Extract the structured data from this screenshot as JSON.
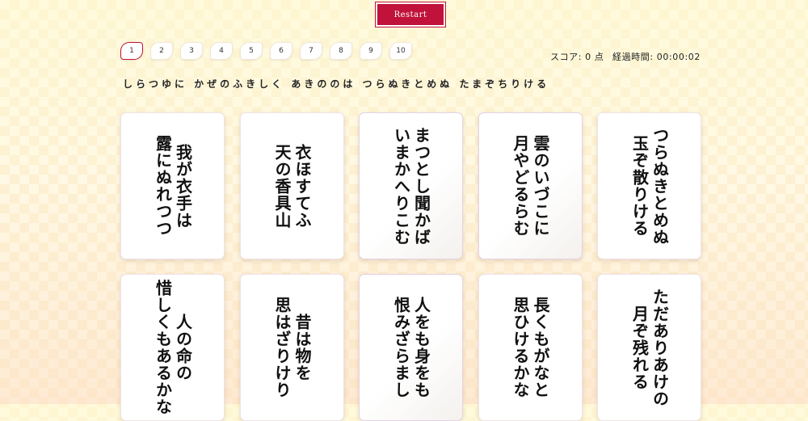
{
  "restart_label": "Restart",
  "rounds": [
    "1",
    "2",
    "3",
    "4",
    "5",
    "6",
    "7",
    "8",
    "9",
    "10"
  ],
  "active_round": "1",
  "score": {
    "label": "スコア: 0 点",
    "time_label": "経過時間: 00:00:02"
  },
  "prompt": "しらつゆに かぜのふきしく あきののは つらぬきとめぬ たまぞちりける",
  "cards": [
    {
      "line1": "我が衣手は",
      "line2": "露にぬれつつ"
    },
    {
      "line1": "衣ほすてふ",
      "line2": "天の香具山"
    },
    {
      "line1": "まつとし聞かば",
      "line2": "いまかへりこむ"
    },
    {
      "line1": "雲のいづこに",
      "line2": "月やどるらむ"
    },
    {
      "line1": "つらぬきとめぬ",
      "line2": "玉ぞ散りける"
    },
    {
      "line1": "人の命の",
      "line2": "惜しくもあるかな"
    },
    {
      "line1": "昔は物を",
      "line2": "思はざりけり"
    },
    {
      "line1": "人をも身をも",
      "line2": "恨みざらまし"
    },
    {
      "line1": "長くもがなと",
      "line2": "思ひけるかな"
    },
    {
      "line1": "ただありあけの",
      "line2": "月ぞ残れる"
    }
  ]
}
